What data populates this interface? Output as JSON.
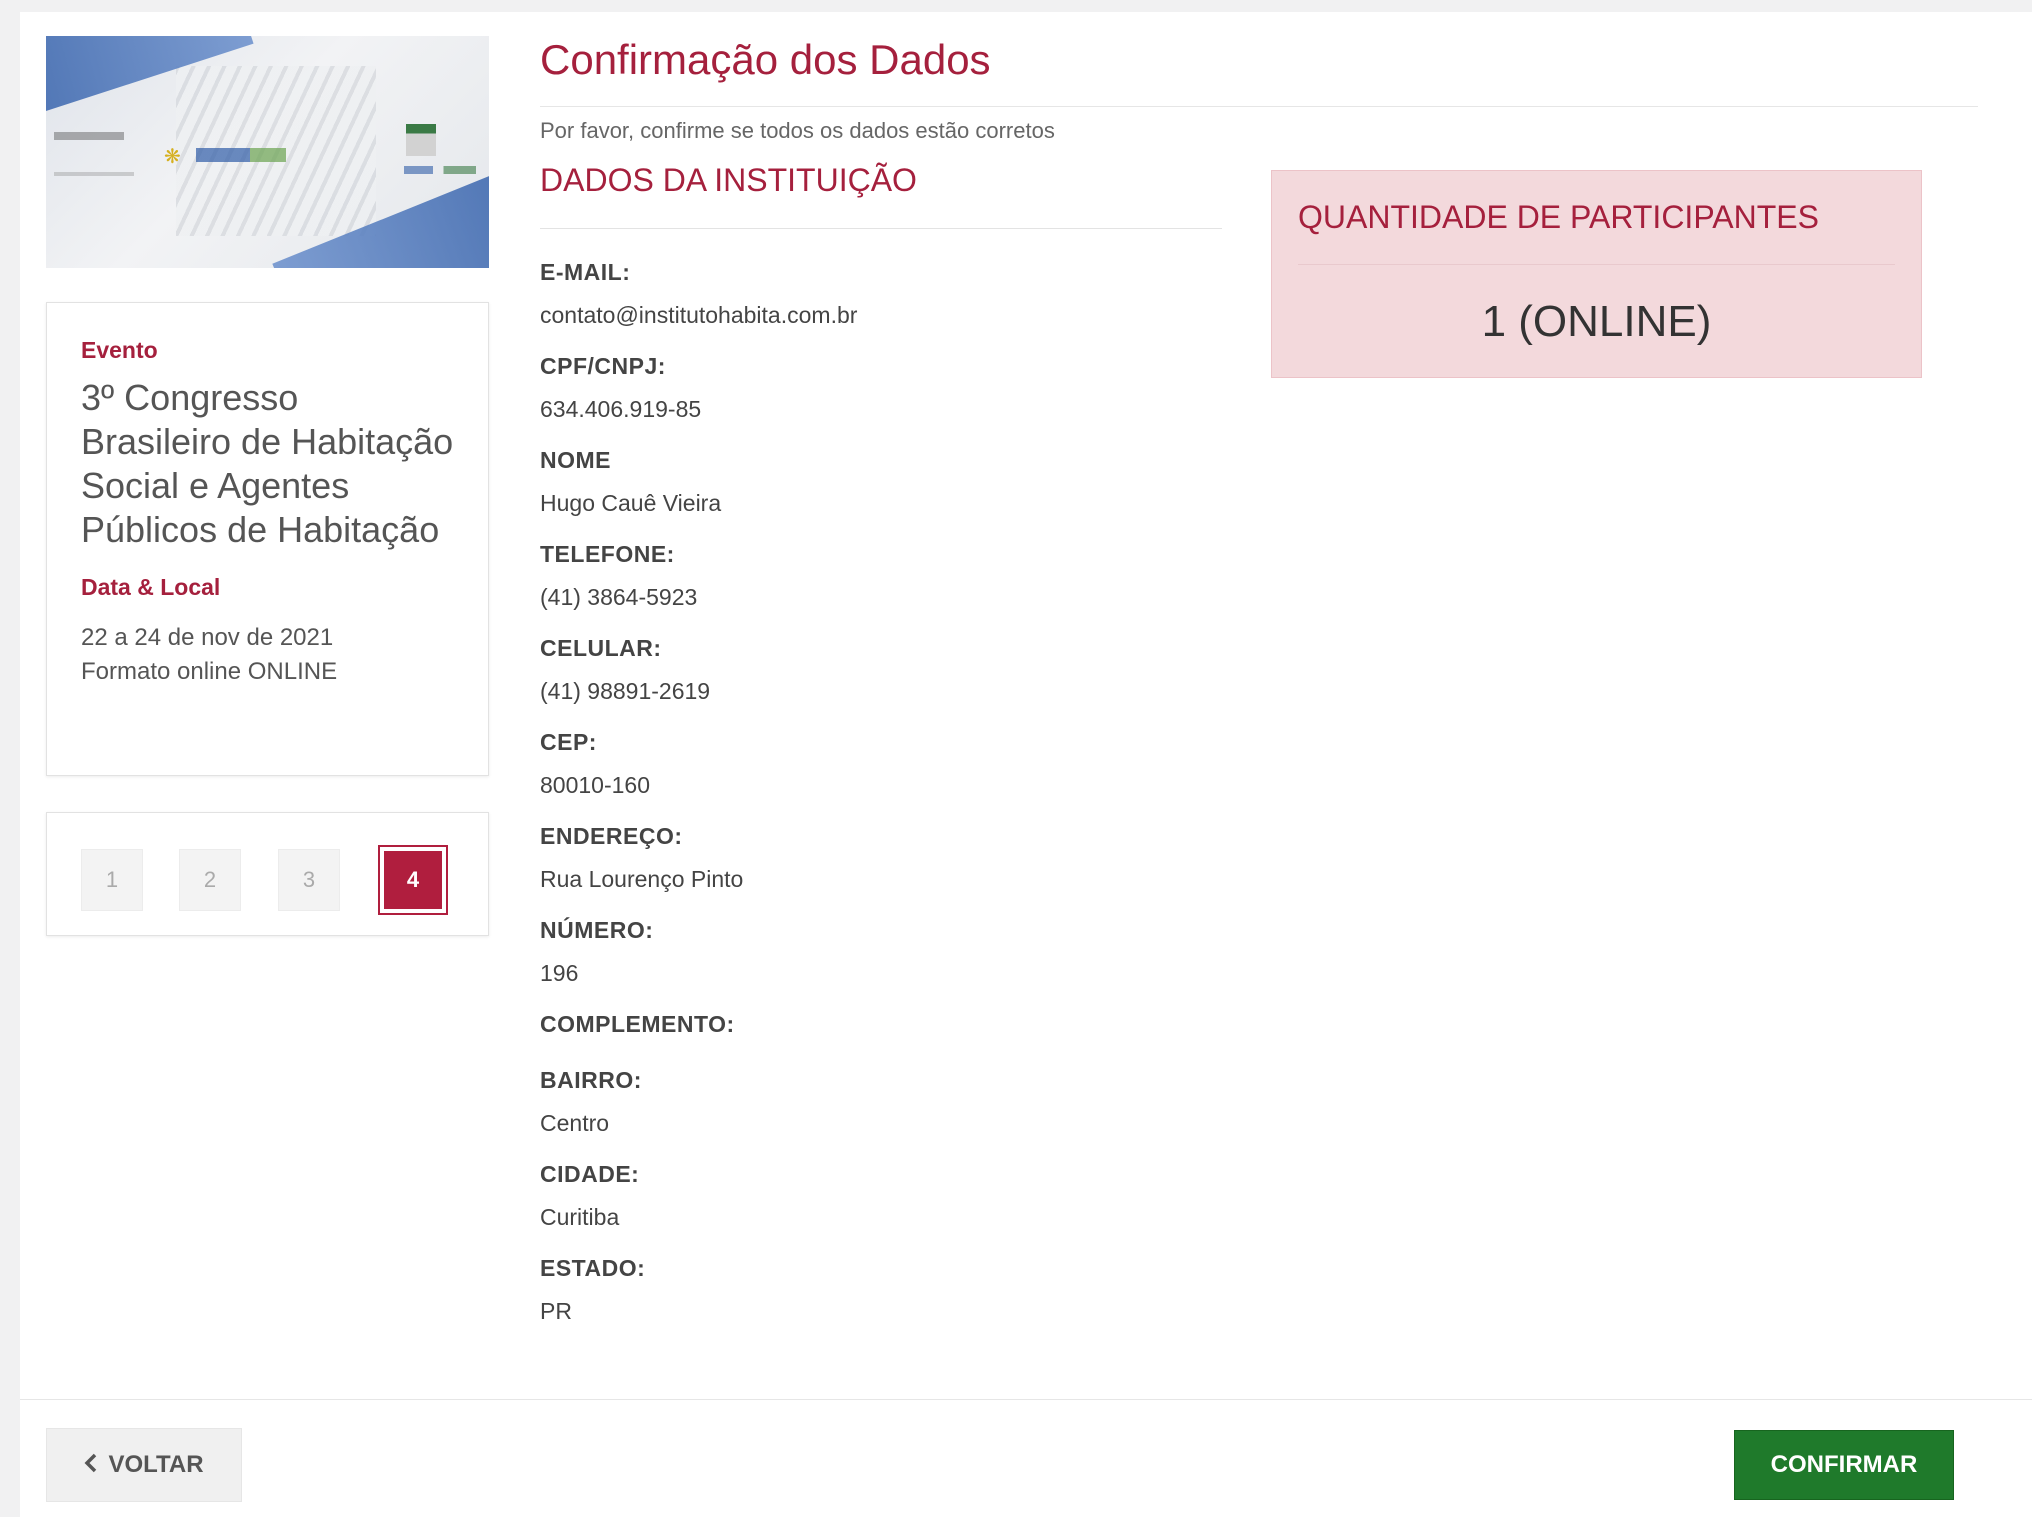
{
  "sidebar": {
    "banner_alt": "",
    "event_label": "Evento",
    "event_title": "3º Congresso Brasileiro de Habitação Social e Agentes Públicos de Habitação",
    "date_place_label": "Data & Local",
    "date_text": "22 a 24 de nov de 2021",
    "format_text": "Formato online ONLINE"
  },
  "steps": [
    {
      "label": "1",
      "active": false
    },
    {
      "label": "2",
      "active": false
    },
    {
      "label": "3",
      "active": false
    },
    {
      "label": "4",
      "active": true
    }
  ],
  "main": {
    "title": "Confirmação dos Dados",
    "subtitle": "Por favor, confirme se todos os dados estão corretos",
    "section_title": "DADOS DA INSTITUIÇÃO",
    "fields": [
      {
        "key": "E-MAIL:",
        "value": "contato@institutohabita.com.br"
      },
      {
        "key": "CPF/CNPJ:",
        "value": "634.406.919-85"
      },
      {
        "key": "NOME",
        "value": "Hugo Cauê Vieira"
      },
      {
        "key": "TELEFONE:",
        "value": "(41) 3864-5923"
      },
      {
        "key": "CELULAR:",
        "value": "(41) 98891-2619"
      },
      {
        "key": "CEP:",
        "value": "80010-160"
      },
      {
        "key": "ENDEREÇO:",
        "value": "Rua Lourenço Pinto"
      },
      {
        "key": "NÚMERO:",
        "value": "196"
      },
      {
        "key": "COMPLEMENTO:",
        "value": ""
      },
      {
        "key": "BAIRRO:",
        "value": "Centro"
      },
      {
        "key": "CIDADE:",
        "value": "Curitiba"
      },
      {
        "key": "ESTADO:",
        "value": "PR"
      }
    ]
  },
  "participants": {
    "title": "QUANTIDADE DE PARTICIPANTES",
    "value": "1 (ONLINE)"
  },
  "footer": {
    "back_label": "VOLTAR",
    "confirm_label": "CONFIRMAR"
  },
  "colors": {
    "accent": "#a5203d",
    "active_step": "#b01e3e",
    "confirm": "#1f7a2b",
    "participants_bg": "#f3d9dc"
  },
  "icons": {
    "back": "chevron-left-icon"
  }
}
